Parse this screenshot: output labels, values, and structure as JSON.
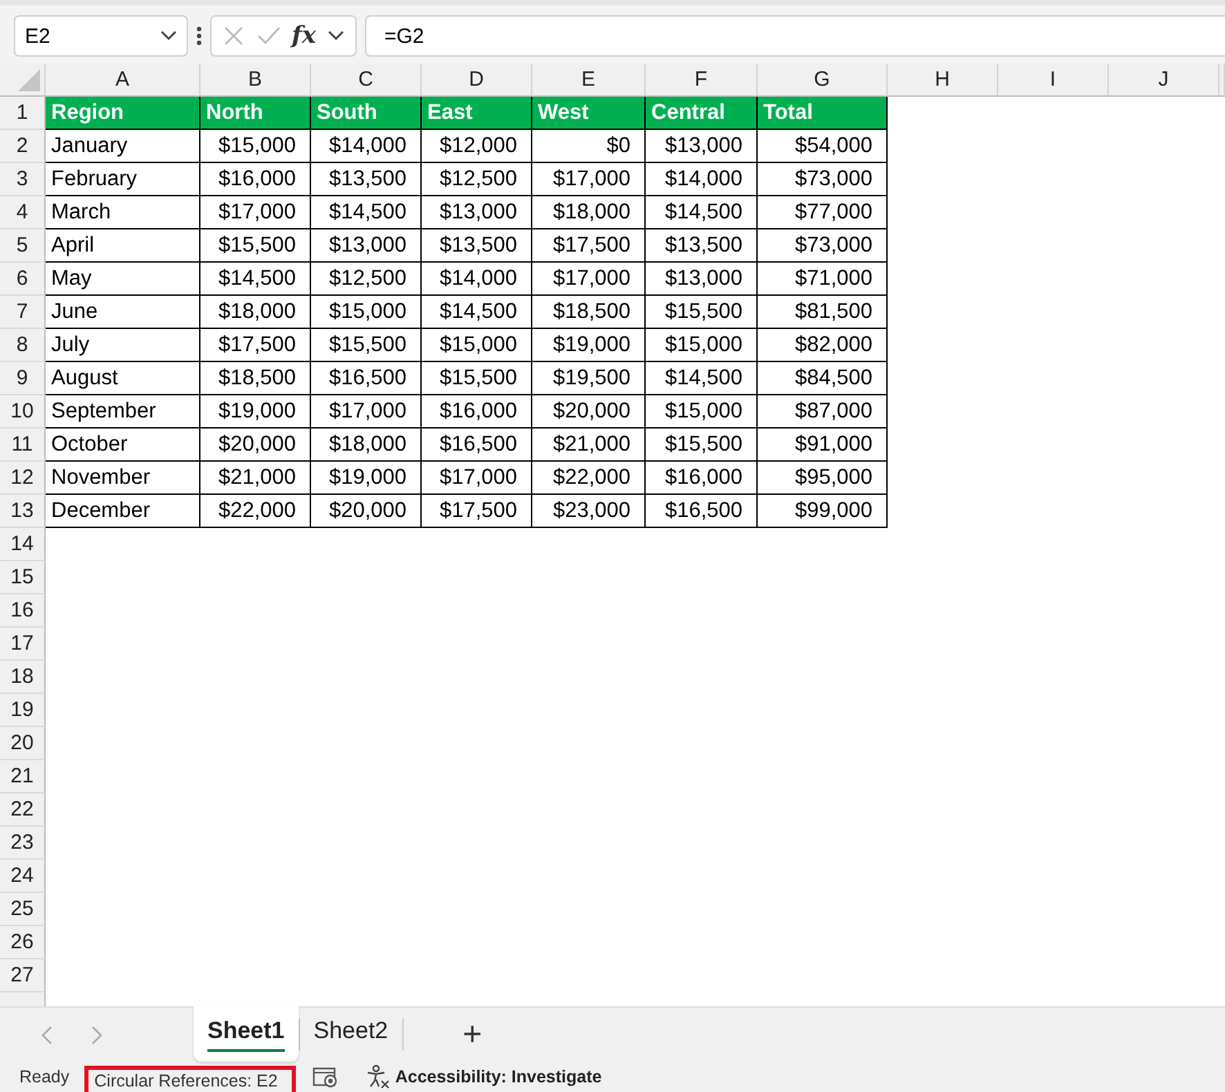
{
  "formula_bar": {
    "name_box": "E2",
    "function_label": "fx",
    "formula": "=G2"
  },
  "columns": [
    "A",
    "B",
    "C",
    "D",
    "E",
    "F",
    "G",
    "H",
    "I",
    "J"
  ],
  "rows": [
    {
      "number": "1",
      "kind": "header",
      "cells": [
        "Region",
        "North",
        "South",
        "East",
        "West",
        "Central",
        "Total"
      ]
    },
    {
      "number": "2",
      "kind": "data",
      "cells": [
        "January",
        "$15,000",
        "$14,000",
        "$12,000",
        "$0",
        "$13,000",
        "$54,000"
      ]
    },
    {
      "number": "3",
      "kind": "data",
      "cells": [
        "February",
        "$16,000",
        "$13,500",
        "$12,500",
        "$17,000",
        "$14,000",
        "$73,000"
      ]
    },
    {
      "number": "4",
      "kind": "data",
      "cells": [
        "March",
        "$17,000",
        "$14,500",
        "$13,000",
        "$18,000",
        "$14,500",
        "$77,000"
      ]
    },
    {
      "number": "5",
      "kind": "data",
      "cells": [
        "April",
        "$15,500",
        "$13,000",
        "$13,500",
        "$17,500",
        "$13,500",
        "$73,000"
      ]
    },
    {
      "number": "6",
      "kind": "data",
      "cells": [
        "May",
        "$14,500",
        "$12,500",
        "$14,000",
        "$17,000",
        "$13,000",
        "$71,000"
      ]
    },
    {
      "number": "7",
      "kind": "data",
      "cells": [
        "June",
        "$18,000",
        "$15,000",
        "$14,500",
        "$18,500",
        "$15,500",
        "$81,500"
      ]
    },
    {
      "number": "8",
      "kind": "data",
      "cells": [
        "July",
        "$17,500",
        "$15,500",
        "$15,000",
        "$19,000",
        "$15,000",
        "$82,000"
      ]
    },
    {
      "number": "9",
      "kind": "data",
      "cells": [
        "August",
        "$18,500",
        "$16,500",
        "$15,500",
        "$19,500",
        "$14,500",
        "$84,500"
      ]
    },
    {
      "number": "10",
      "kind": "data",
      "cells": [
        "September",
        "$19,000",
        "$17,000",
        "$16,000",
        "$20,000",
        "$15,000",
        "$87,000"
      ]
    },
    {
      "number": "11",
      "kind": "data",
      "cells": [
        "October",
        "$20,000",
        "$18,000",
        "$16,500",
        "$21,000",
        "$15,500",
        "$91,000"
      ]
    },
    {
      "number": "12",
      "kind": "data",
      "cells": [
        "November",
        "$21,000",
        "$19,000",
        "$17,000",
        "$22,000",
        "$16,000",
        "$95,000"
      ]
    },
    {
      "number": "13",
      "kind": "data",
      "cells": [
        "December",
        "$22,000",
        "$20,000",
        "$17,500",
        "$23,000",
        "$16,500",
        "$99,000"
      ]
    },
    {
      "number": "14",
      "kind": "empty"
    },
    {
      "number": "15",
      "kind": "empty"
    },
    {
      "number": "16",
      "kind": "empty"
    },
    {
      "number": "17",
      "kind": "empty"
    },
    {
      "number": "18",
      "kind": "empty"
    },
    {
      "number": "19",
      "kind": "empty"
    },
    {
      "number": "20",
      "kind": "empty"
    },
    {
      "number": "21",
      "kind": "empty"
    },
    {
      "number": "22",
      "kind": "empty"
    },
    {
      "number": "23",
      "kind": "empty"
    },
    {
      "number": "24",
      "kind": "empty"
    },
    {
      "number": "25",
      "kind": "empty"
    },
    {
      "number": "26",
      "kind": "empty"
    },
    {
      "number": "27",
      "kind": "empty"
    }
  ],
  "sheets": [
    {
      "label": "Sheet1",
      "selected": true
    },
    {
      "label": "Sheet2",
      "selected": false
    }
  ],
  "add_sheet": "+",
  "status_bar": {
    "mode": "Ready",
    "circular_references": "Circular References: E2",
    "accessibility": "Accessibility: Investigate"
  }
}
